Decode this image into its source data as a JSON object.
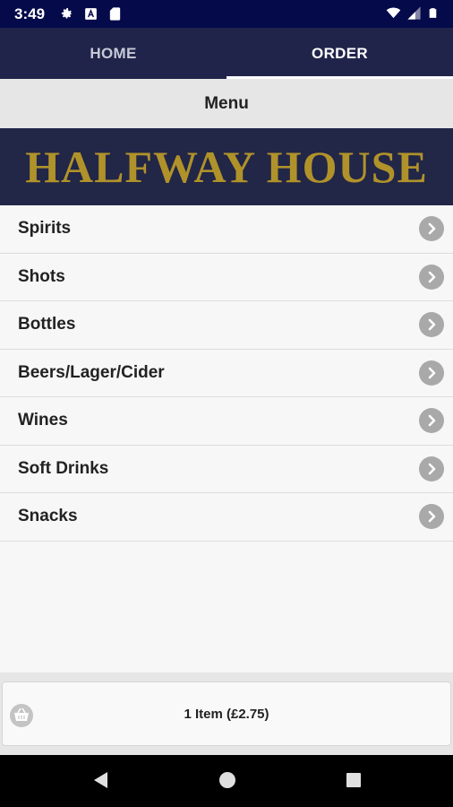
{
  "status_bar": {
    "time": "3:49",
    "icons_left": [
      "settings-icon",
      "a-badge-icon",
      "sd-card-icon"
    ],
    "icons_right": [
      "wifi-icon",
      "signal-icon",
      "battery-icon"
    ]
  },
  "tabs": [
    {
      "label": "HOME",
      "selected": false
    },
    {
      "label": "ORDER",
      "selected": true
    }
  ],
  "header": {
    "title": "Menu"
  },
  "banner": {
    "text": "HALFWAY HOUSE",
    "text_color": "#b0922a",
    "background": "#222647"
  },
  "menu": {
    "items": [
      {
        "label": "Spirits"
      },
      {
        "label": "Shots"
      },
      {
        "label": "Bottles"
      },
      {
        "label": "Beers/Lager/Cider"
      },
      {
        "label": "Wines"
      },
      {
        "label": "Soft Drinks"
      },
      {
        "label": "Snacks"
      }
    ]
  },
  "cart": {
    "summary": "1 Item (£2.75)",
    "icon": "basket-icon"
  },
  "navigation": {
    "buttons": [
      "back-icon",
      "home-icon",
      "recents-icon"
    ]
  },
  "colors": {
    "status_bar": "#050a4a",
    "tab_bar": "#21244a",
    "chevron": "#a9a9a9"
  }
}
